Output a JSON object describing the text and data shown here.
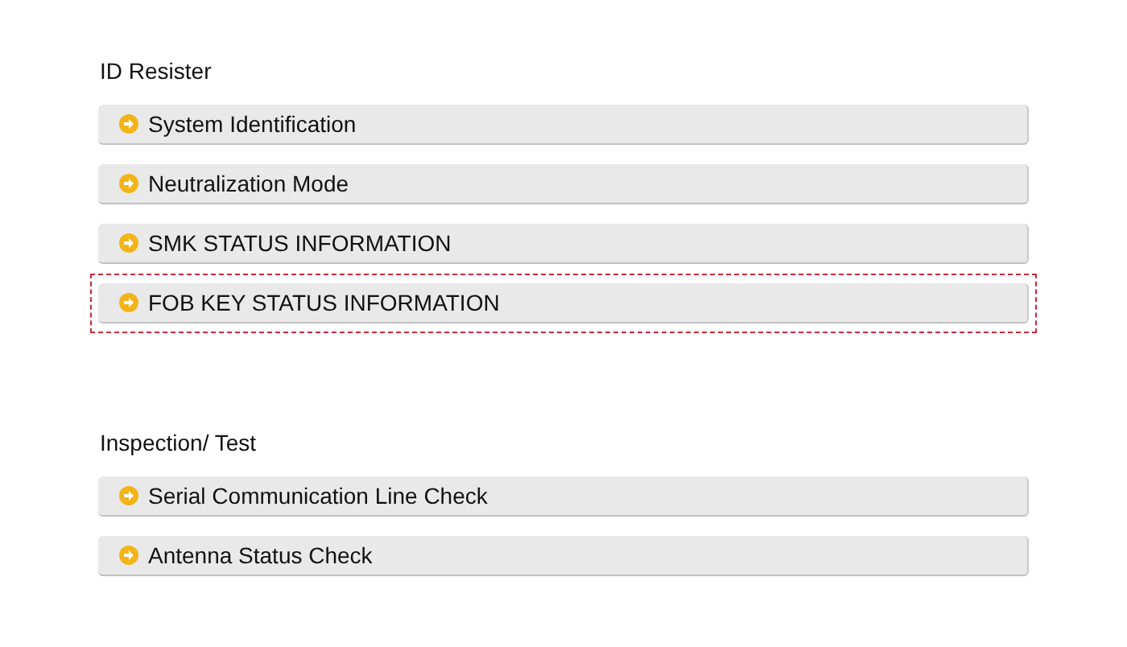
{
  "sections": [
    {
      "heading": "ID Resister",
      "items": [
        {
          "label": "System Identification",
          "selected": false
        },
        {
          "label": "Neutralization Mode",
          "selected": false
        },
        {
          "label": "SMK STATUS INFORMATION",
          "selected": false
        },
        {
          "label": "FOB KEY STATUS INFORMATION",
          "selected": true
        }
      ]
    },
    {
      "heading": "Inspection/ Test",
      "items": [
        {
          "label": "Serial Communication Line Check",
          "selected": false
        },
        {
          "label": "Antenna Status Check",
          "selected": false
        }
      ]
    }
  ]
}
